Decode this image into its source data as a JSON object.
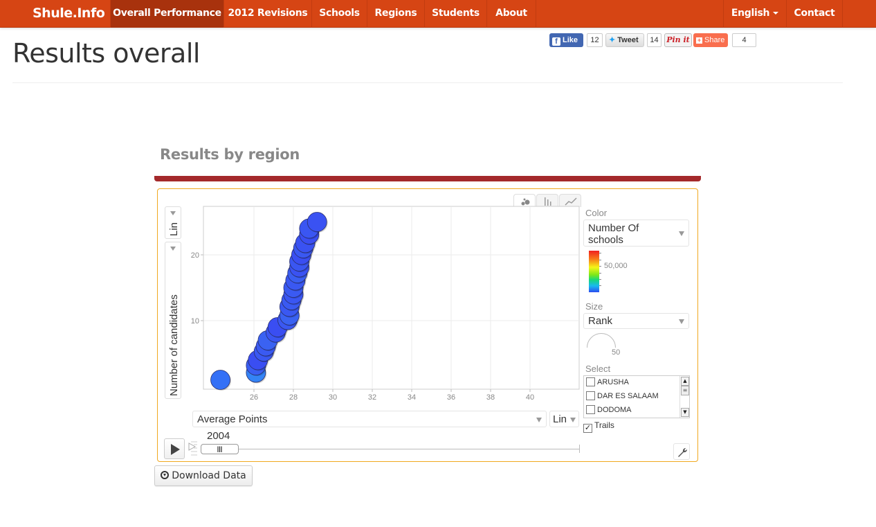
{
  "navbar": {
    "brand": "Shule.Info",
    "items": [
      {
        "label": "Overall Performance",
        "active": true
      },
      {
        "label": "2012 Revisions",
        "active": false
      },
      {
        "label": "Schools",
        "active": false
      },
      {
        "label": "Regions",
        "active": false
      },
      {
        "label": "Students",
        "active": false
      },
      {
        "label": "About",
        "active": false
      }
    ],
    "language": "English",
    "contact": "Contact"
  },
  "social": {
    "like_label": "Like",
    "like_count": "12",
    "tweet_label": "Tweet",
    "tweet_count": "14",
    "pin_label": "Pin it",
    "share_label": "Share",
    "share_count": "4"
  },
  "page": {
    "title": "Results overall",
    "section_title": "Results by region",
    "download_label": "Download Data"
  },
  "motion_chart": {
    "y_scale": "Lin",
    "x_scale": "Lin",
    "x_metric": "Average Points",
    "color_label": "Color",
    "color_metric": "Number Of schools",
    "color_scale_label": "50,000",
    "size_label": "Size",
    "size_metric": "Rank",
    "size_scale_label": "50",
    "select_label": "Select",
    "select_items": [
      "ARUSHA",
      "DAR ES SALAAM",
      "DODOMA"
    ],
    "trails_label": "Trails",
    "trails_checked": true,
    "year": "2004",
    "colors": {
      "bubble_blue": "#3a52f2",
      "bubble_light": "#3478f6",
      "accent_orange": "#d64514",
      "bar_red": "#a4292b",
      "frame_orange": "#f0a81e"
    }
  },
  "chart_data": {
    "type": "scatter",
    "title": "Results by region",
    "xlabel": "Average Points",
    "ylabel": "Number of candidates",
    "xlim": [
      23,
      42
    ],
    "ylim": [
      0,
      28
    ],
    "x_ticks": [
      26,
      28,
      30,
      32,
      34,
      36,
      38,
      40
    ],
    "y_ticks": [
      10,
      20
    ],
    "grid": true,
    "year": "2004",
    "points": [
      {
        "x": 24.3,
        "y": 1.0,
        "color": "#3470f6"
      },
      {
        "x": 26.1,
        "y": 2.1,
        "color": "#3484f6"
      },
      {
        "x": 26.1,
        "y": 3.2,
        "color": "#3a5ef2"
      },
      {
        "x": 26.2,
        "y": 4.0,
        "color": "#3a4ef2"
      },
      {
        "x": 26.5,
        "y": 5.3,
        "color": "#3a58f2"
      },
      {
        "x": 26.6,
        "y": 6.1,
        "color": "#3a5af2"
      },
      {
        "x": 26.7,
        "y": 7.0,
        "color": "#3a62f2"
      },
      {
        "x": 27.1,
        "y": 8.2,
        "color": "#3a56f2"
      },
      {
        "x": 27.2,
        "y": 9.0,
        "color": "#3a4ef2"
      },
      {
        "x": 27.7,
        "y": 10.1,
        "color": "#3a58f2"
      },
      {
        "x": 27.8,
        "y": 10.8,
        "color": "#3a62f2"
      },
      {
        "x": 27.8,
        "y": 12.1,
        "color": "#3a58f2"
      },
      {
        "x": 27.9,
        "y": 13.1,
        "color": "#3a5af2"
      },
      {
        "x": 28.0,
        "y": 14.0,
        "color": "#3a56f2"
      },
      {
        "x": 28.0,
        "y": 15.0,
        "color": "#3a5af2"
      },
      {
        "x": 28.1,
        "y": 16.1,
        "color": "#3a58f2"
      },
      {
        "x": 28.2,
        "y": 17.2,
        "color": "#3a5ef2"
      },
      {
        "x": 28.3,
        "y": 18.1,
        "color": "#3a52f2"
      },
      {
        "x": 28.3,
        "y": 19.0,
        "color": "#3a56f2"
      },
      {
        "x": 28.4,
        "y": 20.0,
        "color": "#3a4ef2"
      },
      {
        "x": 28.5,
        "y": 21.0,
        "color": "#3a58f2"
      },
      {
        "x": 28.6,
        "y": 21.8,
        "color": "#3a52f2"
      },
      {
        "x": 28.8,
        "y": 23.1,
        "color": "#3a4ef2"
      },
      {
        "x": 28.8,
        "y": 24.0,
        "color": "#3a56f2"
      },
      {
        "x": 29.2,
        "y": 25.0,
        "color": "#3a52f2"
      }
    ]
  }
}
